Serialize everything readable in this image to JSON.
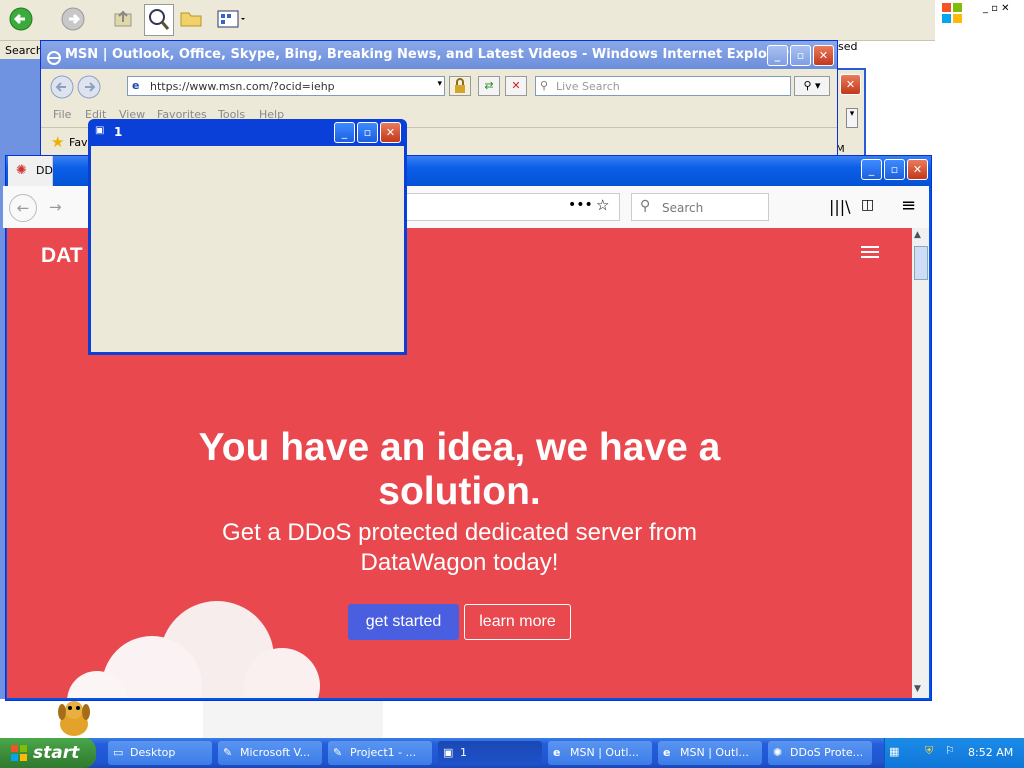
{
  "explorer": {
    "search_pane_label": "Search",
    "right_fragment": "sed"
  },
  "ie_window": {
    "title": "MSN | Outlook, Office, Skype, Bing, Breaking News, and Latest Videos - Windows Internet Explorer",
    "address": "https://www.msn.com/?ocid=iehp",
    "search_placeholder": "Live Search",
    "menu": [
      "File",
      "Edit",
      "View",
      "Favorites",
      "Tools",
      "Help"
    ],
    "favorites_label": "Fav"
  },
  "small_window": {
    "title": "1"
  },
  "firefox": {
    "tab_label": "DD",
    "search_placeholder": "Search",
    "page": {
      "brand": "DAT",
      "headline": "You have an idea, we have a solution.",
      "subtext": "Get a DDoS protected dedicated server from DataWagon today!",
      "primary_button": "get started",
      "secondary_button": "learn more",
      "accent": "#e8484e",
      "button_color": "#4a5fe0"
    }
  },
  "taskbar": {
    "start_label": "start",
    "tasks": [
      {
        "label": "Desktop"
      },
      {
        "label": "Microsoft V..."
      },
      {
        "label": "Project1 - ..."
      },
      {
        "label": "1"
      },
      {
        "label": "MSN | Outl..."
      },
      {
        "label": "MSN | Outl..."
      },
      {
        "label": "DDoS Prote..."
      }
    ],
    "clock": "8:52 AM"
  },
  "ie2_fragment": "M"
}
